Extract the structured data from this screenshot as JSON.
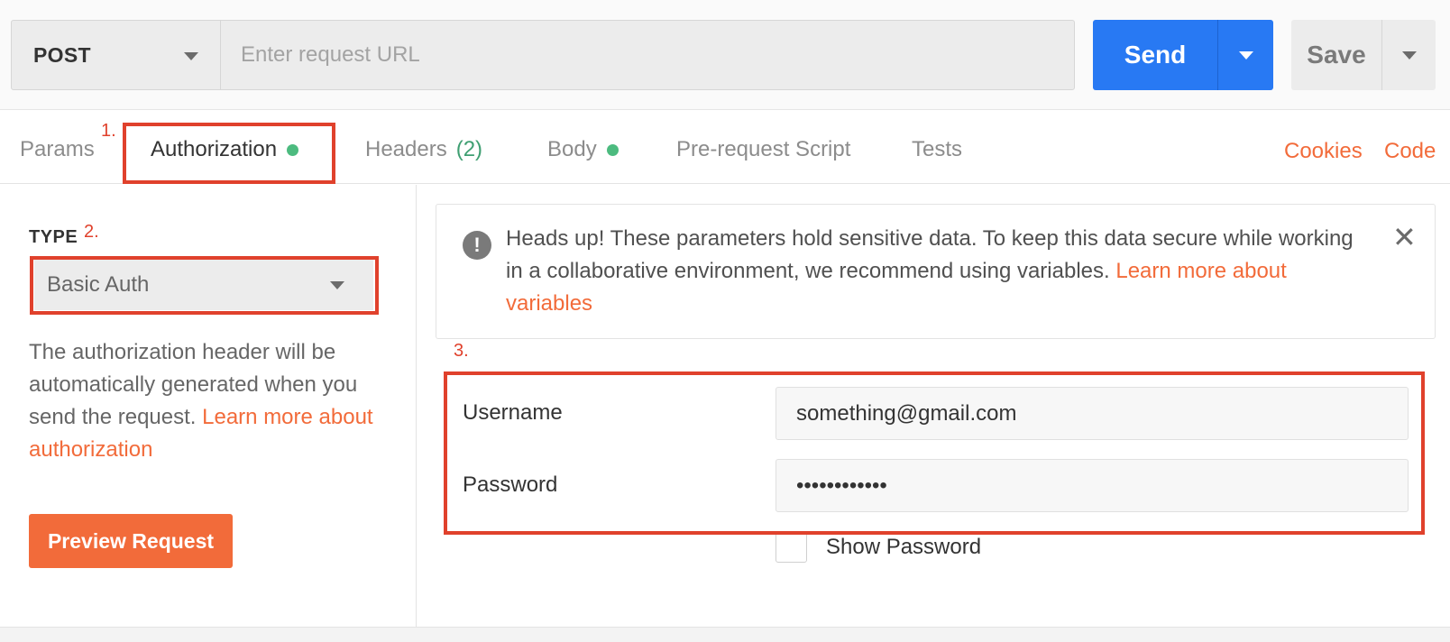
{
  "request": {
    "method": "POST",
    "url_value": "",
    "url_placeholder": "Enter request URL",
    "send_label": "Send",
    "save_label": "Save"
  },
  "tabs": [
    {
      "label": "Params",
      "active": false
    },
    {
      "label": "Authorization",
      "active": true,
      "indicator": "green-dot"
    },
    {
      "label": "Headers",
      "count": "(2)",
      "active": false
    },
    {
      "label": "Body",
      "active": false,
      "indicator": "green-dot"
    },
    {
      "label": "Pre-request Script",
      "active": false
    },
    {
      "label": "Tests",
      "active": false
    }
  ],
  "links": {
    "cookies": "Cookies",
    "code": "Code"
  },
  "annotations": [
    "1.",
    "2.",
    "3."
  ],
  "auth": {
    "type_label": "TYPE",
    "type_value": "Basic Auth",
    "description": "The authorization header will be automatically generated when you send the request. ",
    "description_link": "Learn more about authorization",
    "preview_button": "Preview Request"
  },
  "notice": {
    "icon": "exclamation-circle-icon",
    "text": "Heads up! These parameters hold sensitive data. To keep this data secure while working in a collaborative environment, we recommend using variables. ",
    "link": "Learn more about variables",
    "close_icon": "close-icon"
  },
  "fields": {
    "username_label": "Username",
    "username_value": "something@gmail.com",
    "password_label": "Password",
    "password_value": "••••••••••••",
    "show_password_label": "Show Password",
    "show_password_checked": false
  },
  "colors": {
    "accent_blue": "#2879f3",
    "accent_orange": "#f26b3a",
    "indicator_green": "#4cbb7f",
    "annotation_red": "#e0412c"
  }
}
